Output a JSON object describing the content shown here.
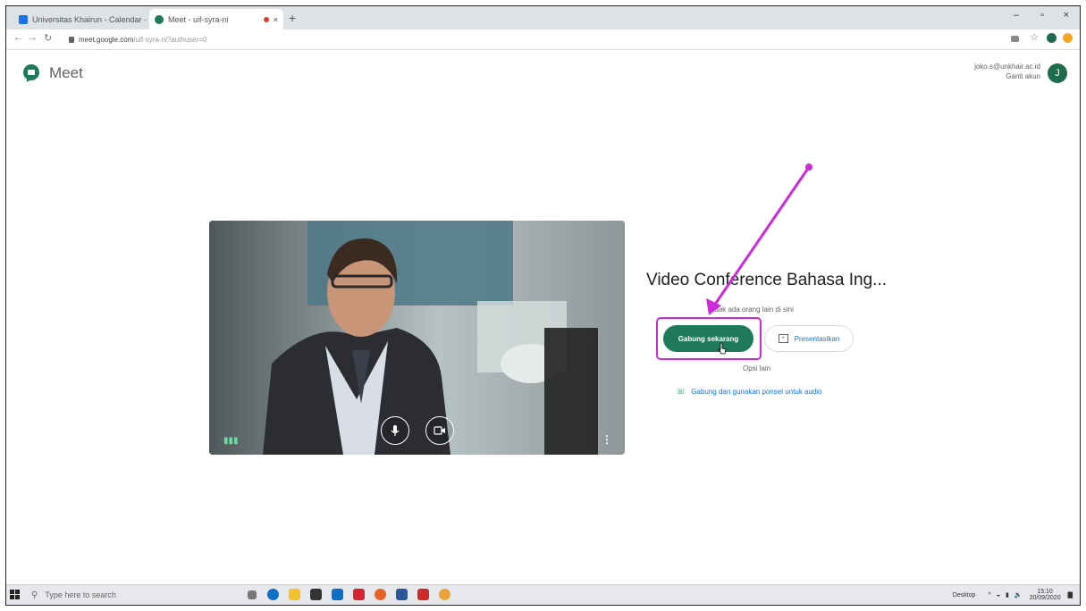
{
  "browser": {
    "tabs": [
      {
        "label": "Universitas Khairun - Calendar - ",
        "icon": "calendar-icon",
        "close": "×"
      },
      {
        "label": "Meet - uif-syra-ni",
        "icon": "meet-icon",
        "close": "×"
      }
    ],
    "new_tab": "+",
    "window_controls": [
      "–",
      "▫",
      "×"
    ],
    "url_host": "meet.google.com",
    "url_path": "/uif-syra-ni?authuser=0"
  },
  "meet": {
    "brand": "Meet",
    "account_email": "joko.s@unkhair.ac.id",
    "switch_account": "Ganti akun",
    "avatar_initial": "J",
    "meeting_title": "Video Conference Bahasa Ing...",
    "no_one_here": "Tidak ada orang lain di sini",
    "join_button": "Gabung sekarang",
    "present_button": "Presentasikan",
    "other_options": "Opsi lain",
    "phone_audio": "Gabung dan gunakan ponsel untuk audio"
  },
  "taskbar": {
    "search_placeholder": "Type here to search",
    "desktop_label": "Desktop",
    "time": "15:10",
    "date": "20/09/2020"
  },
  "colors": {
    "accent_green": "#1f7a5c",
    "annotation": "#cc2bd9"
  }
}
